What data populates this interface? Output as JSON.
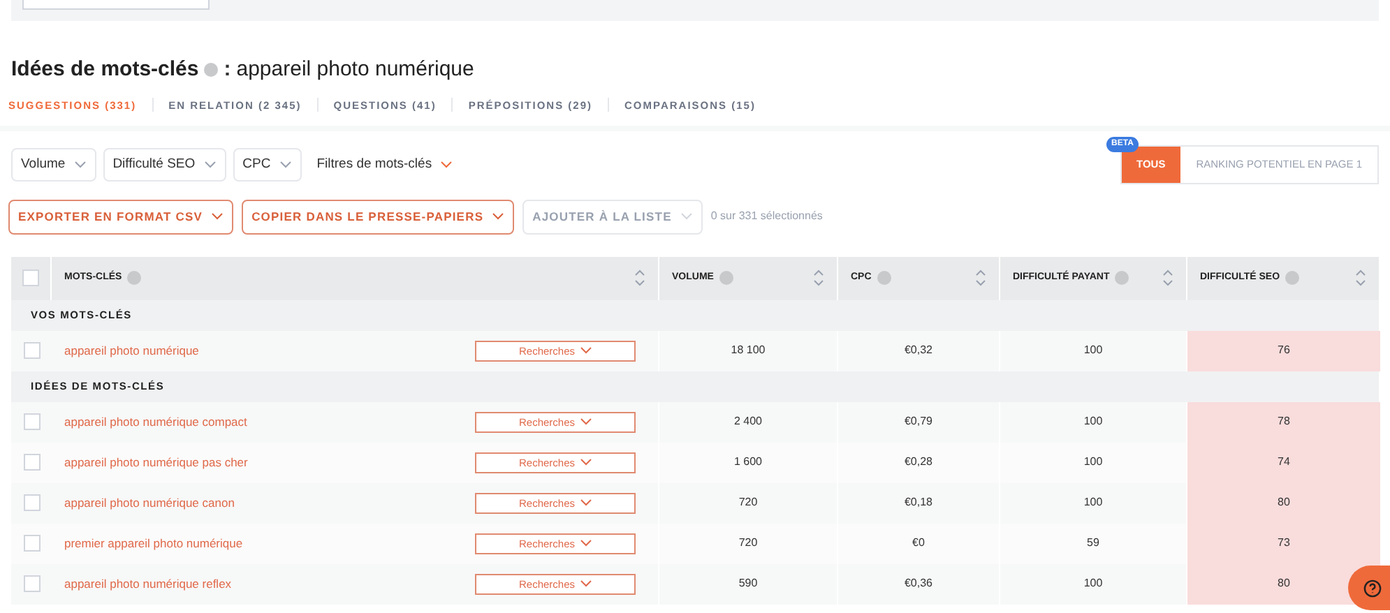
{
  "title": {
    "main": "Idées de mots-clés",
    "separator": ":",
    "query": "appareil photo numérique"
  },
  "tabs": [
    {
      "label": "SUGGESTIONS (331)",
      "selected": true
    },
    {
      "label": "EN RELATION (2 345)",
      "selected": false
    },
    {
      "label": "QUESTIONS (41)",
      "selected": false
    },
    {
      "label": "PRÉPOSITIONS (29)",
      "selected": false
    },
    {
      "label": "COMPARAISONS (15)",
      "selected": false
    }
  ],
  "filters": [
    {
      "label": "Volume",
      "kind": "box"
    },
    {
      "label": "Difficulté SEO",
      "kind": "box"
    },
    {
      "label": "CPC",
      "kind": "box"
    },
    {
      "label": "Filtres de mots-clés",
      "kind": "plain"
    }
  ],
  "ranking_toggle": {
    "badge": "BETA",
    "options": [
      {
        "label": "TOUS",
        "selected": true
      },
      {
        "label": "RANKING POTENTIEL EN PAGE 1",
        "selected": false
      }
    ]
  },
  "actions": [
    {
      "label": "EXPORTER EN FORMAT CSV",
      "disabled": false
    },
    {
      "label": "COPIER DANS LE PRESSE-PAPIERS",
      "disabled": false
    },
    {
      "label": "AJOUTER À LA LISTE",
      "disabled": true
    }
  ],
  "selection_count": "0 sur 331 sélectionnés",
  "table": {
    "select_all_checked": false,
    "columns": [
      "MOTS-CLÉS",
      "VOLUME",
      "CPC",
      "DIFFICULTÉ PAYANT",
      "DIFFICULTÉ SEO"
    ],
    "sections": [
      {
        "label": "VOS MOTS-CLÉS",
        "rows": [
          {
            "keyword": "appareil photo numérique",
            "action": "Recherches",
            "volume": "18 100",
            "cpc": "€0,32",
            "paid": "100",
            "seo": "76",
            "checked": false
          }
        ]
      },
      {
        "label": "IDÉES DE MOTS-CLÉS",
        "rows": [
          {
            "keyword": "appareil photo numérique compact",
            "action": "Recherches",
            "volume": "2 400",
            "cpc": "€0,79",
            "paid": "100",
            "seo": "78",
            "checked": false
          },
          {
            "keyword": "appareil photo numérique pas cher",
            "action": "Recherches",
            "volume": "1 600",
            "cpc": "€0,28",
            "paid": "100",
            "seo": "74",
            "checked": false
          },
          {
            "keyword": "appareil photo numérique canon",
            "action": "Recherches",
            "volume": "720",
            "cpc": "€0,18",
            "paid": "100",
            "seo": "80",
            "checked": false
          },
          {
            "keyword": "premier appareil photo numérique",
            "action": "Recherches",
            "volume": "720",
            "cpc": "€0",
            "paid": "59",
            "seo": "73",
            "checked": false
          },
          {
            "keyword": "appareil photo numérique reflex",
            "action": "Recherches",
            "volume": "590",
            "cpc": "€0,36",
            "paid": "100",
            "seo": "80",
            "checked": false
          }
        ]
      }
    ]
  }
}
